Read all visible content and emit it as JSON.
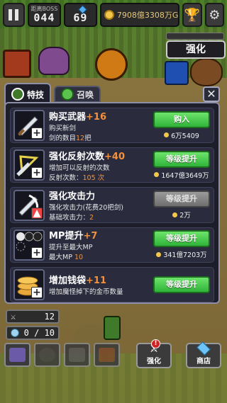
{
  "topbar": {
    "boss_label": "距离BOSS",
    "boss_value": "044",
    "gem_value": "69",
    "gold_value": "7908億3308万G"
  },
  "header": {
    "title": "强化"
  },
  "tabs": [
    {
      "label": "特技",
      "active": true
    },
    {
      "label": "召唤",
      "active": false
    }
  ],
  "rows": [
    {
      "title": "购买武器",
      "bonus": "+16",
      "line1": "购买新剑",
      "line2_prefix": "剑的数目",
      "line2_value": "12",
      "line2_suffix": "把",
      "button": "购入",
      "cost": "6万5409",
      "enabled": true
    },
    {
      "title": "强化反射次数",
      "bonus": "+40",
      "line1": "增加可以反射的次数",
      "line2_prefix": "反射次数：",
      "line2_value": "105",
      "line2_suffix": " 次",
      "button": "等级提升",
      "cost": "1647億3649万",
      "enabled": true
    },
    {
      "title": "强化攻击力",
      "bonus": "",
      "line1": "强化攻击力(花费20把剑)",
      "line2_prefix": "基础攻击力：",
      "line2_value": "2",
      "line2_suffix": "",
      "button": "等级提升",
      "cost": "2万",
      "enabled": false
    },
    {
      "title": "MP提升",
      "bonus": "+7",
      "line1": "提升至最大MP",
      "line2_prefix": "最大MP ",
      "line2_value": "10",
      "line2_suffix": "",
      "button": "等级提升",
      "cost": "341億7203万",
      "enabled": true
    },
    {
      "title": "增加钱袋",
      "bonus": "+11",
      "line1": "增加魔怪掉下的金币数量",
      "line2_prefix": "",
      "line2_value": "",
      "line2_suffix": "",
      "button": "等级提升",
      "cost": "",
      "enabled": true
    }
  ],
  "hud": {
    "swords": "12",
    "orbs": "0 / 10"
  },
  "bottom": {
    "enhance_label": "强化",
    "shop_label": "商店",
    "badge": "!"
  },
  "colors": {
    "accent_orange": "#f3913c",
    "button_green": "#2fb33a",
    "panel_bg": "#1d1e2a"
  }
}
